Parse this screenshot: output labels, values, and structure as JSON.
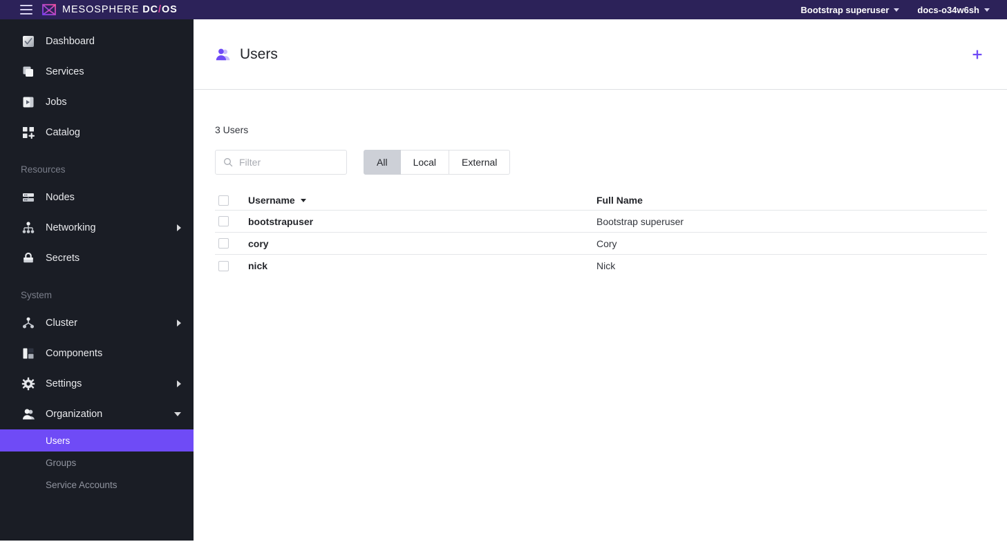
{
  "topbar": {
    "menu_icon": "hamburger-icon",
    "brand_mark": "dcos-logo-icon",
    "brand_name": "MESOSPHERE",
    "brand_dc": "DC",
    "brand_slash": "/",
    "brand_os": "OS",
    "user_menu": "Bootstrap superuser",
    "cluster_menu": "docs-o34w6sh"
  },
  "sidebar": {
    "primary": [
      {
        "label": "Dashboard",
        "icon": "dashboard-icon",
        "expandable": false
      },
      {
        "label": "Services",
        "icon": "services-icon",
        "expandable": false
      },
      {
        "label": "Jobs",
        "icon": "jobs-icon",
        "expandable": false
      },
      {
        "label": "Catalog",
        "icon": "catalog-icon",
        "expandable": false
      }
    ],
    "resources_label": "Resources",
    "resources": [
      {
        "label": "Nodes",
        "icon": "nodes-icon",
        "expandable": false
      },
      {
        "label": "Networking",
        "icon": "networking-icon",
        "expandable": true
      },
      {
        "label": "Secrets",
        "icon": "secrets-lock-icon",
        "expandable": false
      }
    ],
    "system_label": "System",
    "system": [
      {
        "label": "Cluster",
        "icon": "cluster-icon",
        "expandable": true
      },
      {
        "label": "Components",
        "icon": "components-icon",
        "expandable": false
      },
      {
        "label": "Settings",
        "icon": "gear-icon",
        "expandable": true
      },
      {
        "label": "Organization",
        "icon": "organization-icon",
        "expandable": true,
        "expanded": true
      }
    ],
    "organization_children": [
      {
        "label": "Users",
        "active": true
      },
      {
        "label": "Groups",
        "active": false
      },
      {
        "label": "Service Accounts",
        "active": false
      }
    ]
  },
  "page": {
    "title": "Users",
    "title_icon": "users-icon",
    "add_icon": "plus-icon",
    "count_text": "3 Users"
  },
  "toolbar": {
    "filter_placeholder": "Filter",
    "filter_value": "",
    "search_icon": "search-icon",
    "segments": [
      {
        "label": "All",
        "active": true
      },
      {
        "label": "Local",
        "active": false
      },
      {
        "label": "External",
        "active": false
      }
    ]
  },
  "table": {
    "columns": [
      {
        "label": "Username",
        "sorted": true,
        "sort_direction": "desc"
      },
      {
        "label": "Full Name",
        "sorted": false
      }
    ],
    "rows": [
      {
        "username": "bootstrapuser",
        "full_name": "Bootstrap superuser",
        "checked": false
      },
      {
        "username": "cory",
        "full_name": "Cory",
        "checked": false
      },
      {
        "username": "nick",
        "full_name": "Nick",
        "checked": false
      }
    ]
  },
  "colors": {
    "topbar_bg": "#2C2259",
    "sidebar_bg": "#1A1D25",
    "accent_purple": "#6F4BF6",
    "brand_pink": "#E0479E",
    "segment_active_bg": "#CDD0D7",
    "border_gray": "#DFE1E5"
  }
}
